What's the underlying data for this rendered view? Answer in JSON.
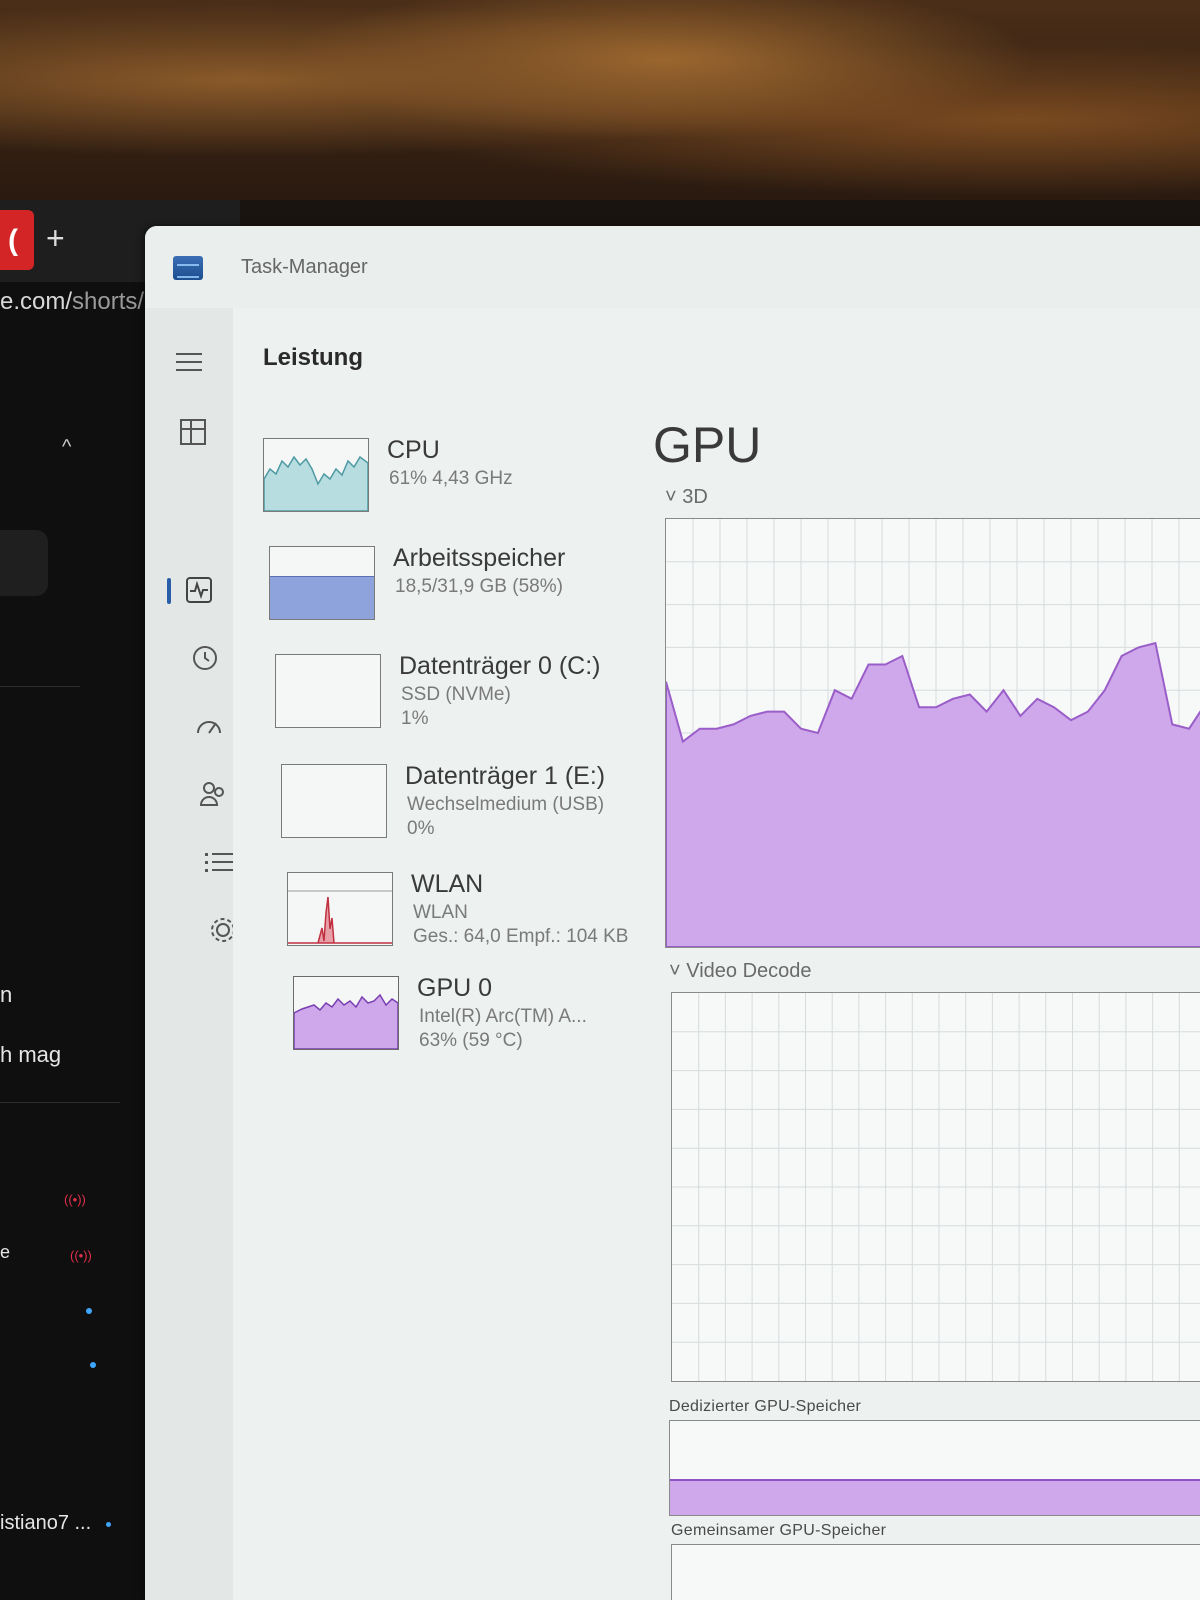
{
  "browser": {
    "url_main": "e.com/",
    "url_path": "shorts/",
    "new_tab": "+",
    "tab_glyph": "(",
    "chevron": "^",
    "list_items": [
      "n",
      "h mag",
      "e",
      "istiano7 ..."
    ]
  },
  "window": {
    "title": "Task-Manager"
  },
  "nav": {
    "section_title": "Leistung",
    "icons": [
      "hamburger-icon",
      "processes-icon",
      "performance-icon",
      "app-history-icon",
      "startup-icon",
      "users-icon",
      "details-icon",
      "services-icon"
    ]
  },
  "perf_items": [
    {
      "name": "CPU",
      "sub1": "61% 4,43 GHz",
      "sub2": ""
    },
    {
      "name": "Arbeitsspeicher",
      "sub1": "18,5/31,9 GB (58%)",
      "sub2": ""
    },
    {
      "name": "Datenträger 0 (C:)",
      "sub1": "SSD (NVMe)",
      "sub2": "1%"
    },
    {
      "name": "Datenträger 1 (E:)",
      "sub1": "Wechselmedium (USB)",
      "sub2": "0%"
    },
    {
      "name": "WLAN",
      "sub1": "WLAN",
      "sub2": "Ges.: 64,0 Empf.: 104 KB"
    },
    {
      "name": "GPU 0",
      "sub1": "Intel(R) Arc(TM) A...",
      "sub2": "63% (59 °C)"
    }
  ],
  "detail": {
    "title": "GPU",
    "engine1": "3D",
    "engine2": "Video Decode",
    "dedicated_label": "Dedizierter GPU-Speicher",
    "shared_label": "Gemeinsamer GPU-Speicher",
    "chevron": "˅"
  },
  "colors": {
    "cpu": "#5aa8b0",
    "memory": "#7a8fd0",
    "network": "#c03040",
    "gpu": "#9a5ec8",
    "gpu_fill": "#cfa8ec"
  },
  "metrics": {
    "memory_used_fraction": 0.58,
    "gpu_3d_history_percent": [
      62,
      48,
      51,
      51,
      52,
      54,
      55,
      55,
      51,
      50,
      60,
      58,
      66,
      66,
      68,
      56,
      56,
      58,
      59,
      55,
      60,
      54,
      58,
      56,
      53,
      55,
      60,
      68,
      70,
      71,
      52,
      51,
      57
    ]
  }
}
